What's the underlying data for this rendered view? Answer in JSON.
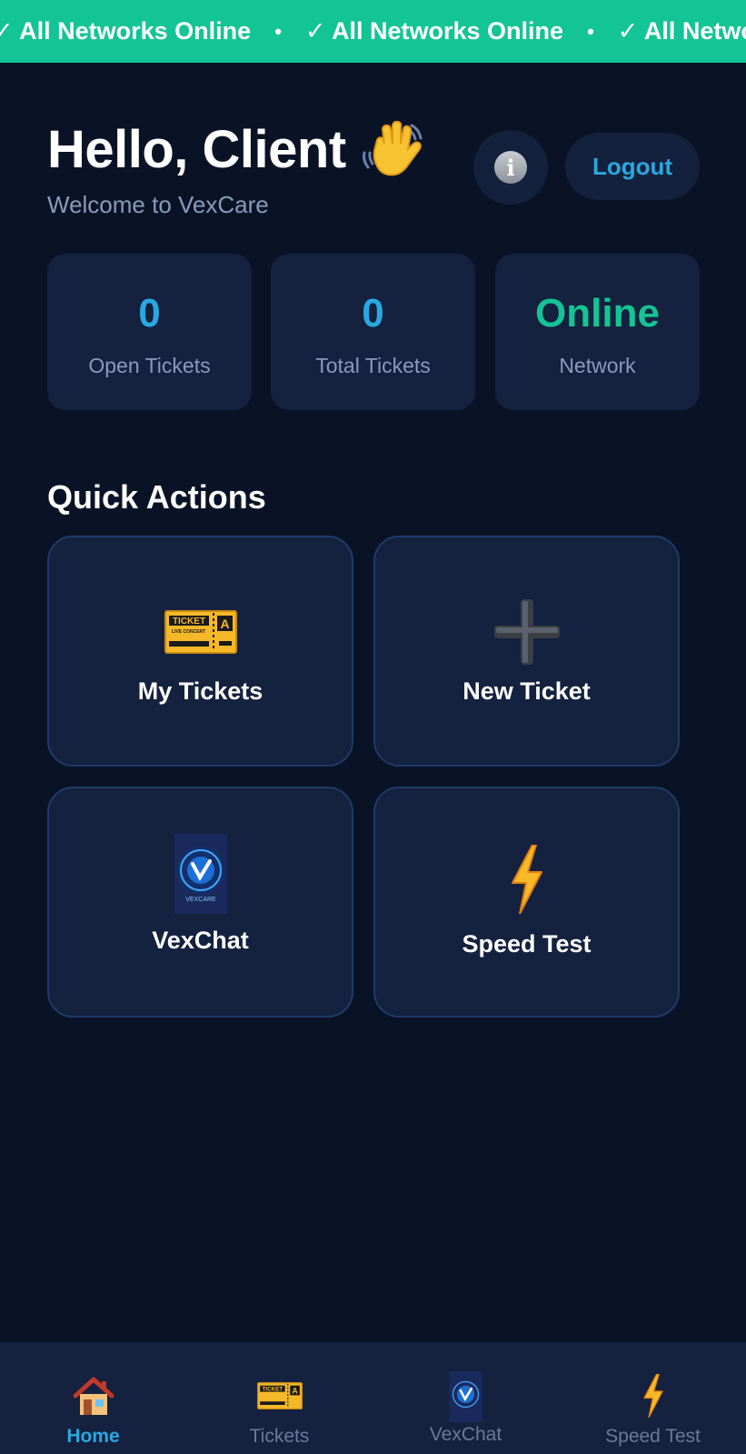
{
  "ticker": {
    "items": [
      "✓ All Networks Online",
      "✓ All Networks Online",
      "✓ All Networks Online"
    ],
    "separator": "•"
  },
  "header": {
    "greeting": "Hello, Client",
    "subtitle": "Welcome to VexCare",
    "info_icon": "info-icon",
    "logout_label": "Logout"
  },
  "stats": [
    {
      "value": "0",
      "label": "Open Tickets"
    },
    {
      "value": "0",
      "label": "Total Tickets"
    },
    {
      "value": "Online",
      "label": "Network"
    }
  ],
  "quick_actions": {
    "title": "Quick Actions",
    "items": [
      {
        "label": "My Tickets",
        "icon": "ticket-icon"
      },
      {
        "label": "New Ticket",
        "icon": "plus-icon"
      },
      {
        "label": "VexChat",
        "icon": "vexcare-logo-icon"
      },
      {
        "label": "Speed Test",
        "icon": "lightning-icon"
      }
    ]
  },
  "bottom_nav": [
    {
      "label": "Home",
      "icon": "house-icon",
      "active": true
    },
    {
      "label": "Tickets",
      "icon": "ticket-icon",
      "active": false
    },
    {
      "label": "VexChat",
      "icon": "vexcare-logo-icon",
      "active": false
    },
    {
      "label": "Speed Test",
      "icon": "lightning-icon",
      "active": false
    }
  ],
  "colors": {
    "background": "#0a1326",
    "card": "#14213f",
    "accent_blue": "#29a8e0",
    "accent_green": "#13c495",
    "muted_text": "#8a9bb8"
  }
}
